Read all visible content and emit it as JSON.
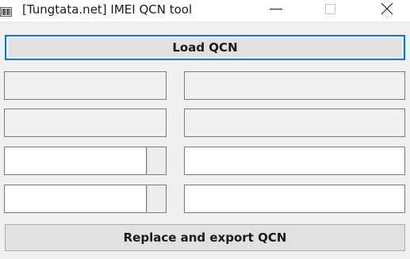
{
  "window": {
    "title": "[Tungtata.net] IMEI QCN tool",
    "app_icon": "barcode-icon",
    "controls": {
      "minimize_icon": "minimize-icon",
      "maximize_icon": "maximize-icon",
      "close_icon": "close-icon"
    }
  },
  "main": {
    "load_button_label": "Load QCN",
    "replace_button_label": "Replace and export QCN",
    "fields": [
      {
        "value": ""
      },
      {
        "value": ""
      },
      {
        "value": ""
      },
      {
        "value": ""
      },
      {
        "value": ""
      },
      {
        "value": ""
      },
      {
        "value": ""
      },
      {
        "value": ""
      }
    ]
  },
  "colors": {
    "focus_border": "#0078d7",
    "button_face": "#e1e1e1",
    "window_background": "#f0f0f0"
  }
}
